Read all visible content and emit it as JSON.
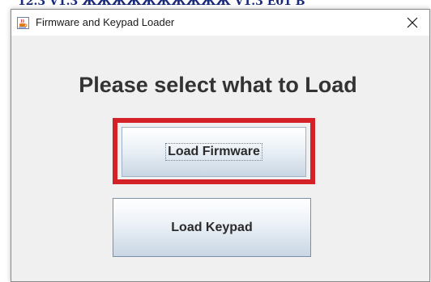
{
  "background": {
    "partial_text": "12.3 V1.3 ЖЖЖЖЖЖЖЖЖЖ   V1.3   E01 B"
  },
  "window": {
    "title": "Firmware and Keypad Loader",
    "icon": "java-coffee-icon",
    "close_icon": "close-icon"
  },
  "main": {
    "heading": "Please select what to Load",
    "buttons": {
      "load_firmware": "Load Firmware",
      "load_keypad": "Load Keypad"
    }
  },
  "colors": {
    "highlight": "#d42027",
    "window_bg": "#f0f0f0",
    "heading": "#333333"
  }
}
